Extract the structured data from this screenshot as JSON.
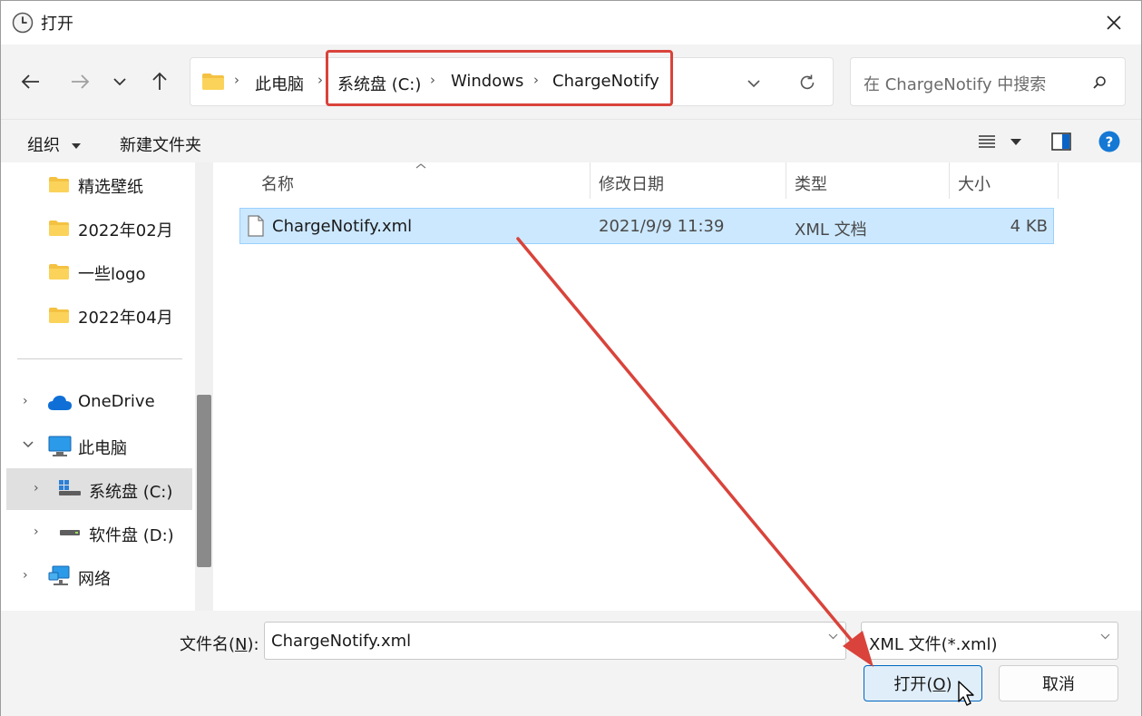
{
  "window": {
    "title": "打开",
    "accent_color": "#0067c0",
    "annotation_color": "#d9433b"
  },
  "addressbar": {
    "crumbs": [
      "此电脑",
      "系统盘 (C:)",
      "Windows",
      "ChargeNotify"
    ],
    "separator": "›"
  },
  "search": {
    "placeholder": "在 ChargeNotify 中搜索"
  },
  "toolbar": {
    "organize_label": "组织",
    "new_folder_label": "新建文件夹"
  },
  "navpane": {
    "quick_folders": [
      "精选壁纸",
      "2022年02月",
      "一些logo",
      "2022年04月"
    ],
    "onedrive": "OneDrive",
    "this_pc": "此电脑",
    "drive_c": "系统盘 (C:)",
    "drive_d": "软件盘 (D:)",
    "network": "网络"
  },
  "filelist": {
    "columns": {
      "name": "名称",
      "modified": "修改日期",
      "type": "类型",
      "size": "大小"
    },
    "rows": [
      {
        "name": "ChargeNotify.xml",
        "modified": "2021/9/9 11:39",
        "type": "XML 文档",
        "size": "4 KB"
      }
    ]
  },
  "bottom": {
    "filename_label_prefix": "文件名(",
    "filename_label_key": "N",
    "filename_label_suffix": "):",
    "filename_value": "ChargeNotify.xml",
    "filetype_value": "XML 文件(*.xml)",
    "open_label_prefix": "打开(",
    "open_label_key": "O",
    "open_label_suffix": ")",
    "cancel_label": "取消"
  }
}
